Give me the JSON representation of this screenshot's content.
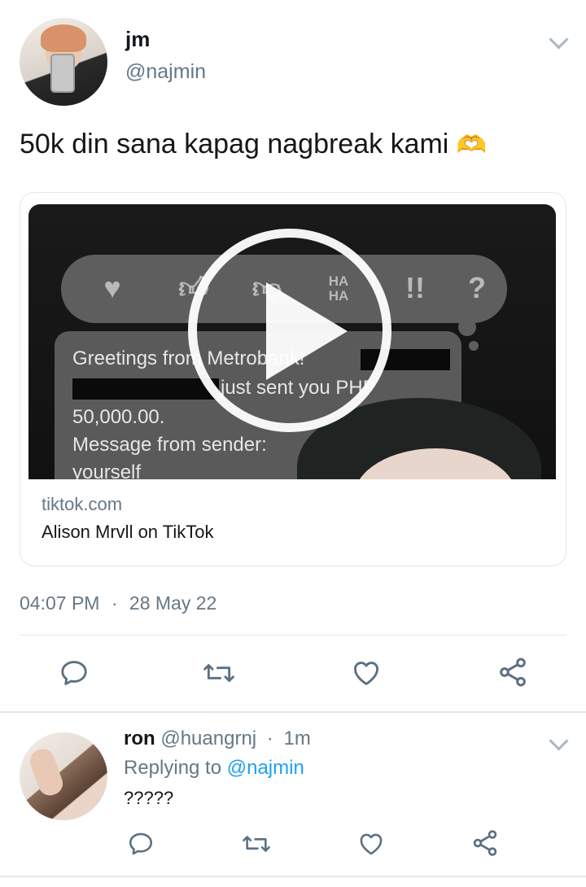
{
  "tweet": {
    "author_name": "jm",
    "author_handle": "@najmin",
    "text": "50k din sana kapag nagbreak kami",
    "emoji": "🫶",
    "card": {
      "domain": "tiktok.com",
      "title": "Alison Mrvll on TikTok",
      "media_text": {
        "line1": "Greetings from Metrobank!",
        "line2": "just sent you PHP",
        "line3": "50,000.00.",
        "line4": "Message from sender:",
        "line5": "yourself"
      }
    },
    "time": "04:07 PM",
    "separator": "·",
    "date": "28 May 22",
    "actions": [
      "reply-icon",
      "retweet-icon",
      "like-icon",
      "share-icon"
    ]
  },
  "reply": {
    "author_name": "ron",
    "author_handle": "@huangrnj",
    "separator": "·",
    "age": "1m",
    "replying_prefix": "Replying to",
    "replying_mention": "@najmin",
    "text": "?????",
    "actions": [
      "reply-icon",
      "retweet-icon",
      "like-icon",
      "share-icon"
    ]
  },
  "colors": {
    "text": "#14171a",
    "muted": "#657786",
    "link": "#1da1f2",
    "border": "#e1e8ed",
    "icon": "#5b7083"
  }
}
